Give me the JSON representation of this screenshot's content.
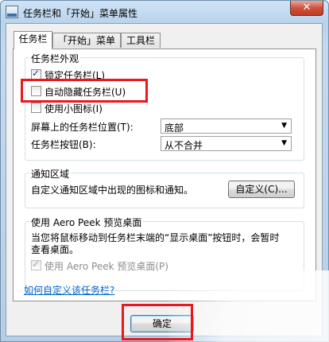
{
  "window": {
    "title": "任务栏和「开始」菜单属性",
    "close_label": "✕"
  },
  "tabs": [
    "任务栏",
    "「开始」菜单",
    "工具栏"
  ],
  "appearance": {
    "title": "任务栏外观",
    "lock_label": "锁定任务栏(L)",
    "lock_checked": true,
    "autohide_label": "自动隐藏任务栏(U)",
    "autohide_checked": false,
    "small_icons_label": "使用小图标(I)",
    "small_icons_checked": false,
    "location_label": "屏幕上的任务栏位置(T):",
    "location_value": "底部",
    "buttons_label": "任务栏按钮(B):",
    "buttons_value": "从不合并"
  },
  "notify": {
    "title": "通知区域",
    "desc": "自定义通知区域中出现的图标和通知。",
    "customize_button": "自定义(C)..."
  },
  "aero": {
    "title": "使用 Aero Peek 预览桌面",
    "desc_line1": "当您将鼠标移动到任务栏末端的“显示桌面”按钮时，会暂时",
    "desc_line2": "查看桌面。",
    "checkbox_label": "使用 Aero Peek 预览桌面(P)",
    "checkbox_checked": true,
    "checkbox_disabled": true
  },
  "help_link": "如何自定义该任务栏?",
  "ok_button": "确定",
  "colors": {
    "highlight": "#e8181e",
    "link": "#0066cc"
  }
}
